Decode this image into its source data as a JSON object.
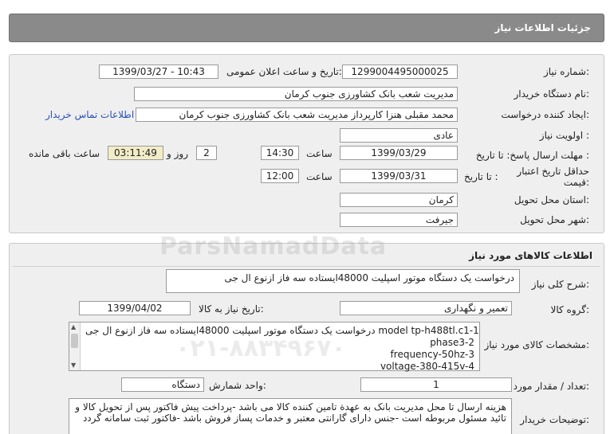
{
  "header": {
    "title": "جزئیات اطلاعات نیاز"
  },
  "details": {
    "need_number_label": "شماره نیاز:",
    "need_number": "1299004495000025",
    "announce_label": "تاریخ و ساعت اعلان عمومی:",
    "announce_value": "1399/03/27 - 10:43",
    "buyer_label": "نام دستگاه خریدار:",
    "buyer_value": "مدیریت شعب بانک کشاورزی جنوب کرمان",
    "creator_label": "ایجاد کننده درخواست:",
    "creator_value": "محمد مقبلی هنزا کارپرداز مدیریت شعب بانک کشاورزی جنوب کرمان",
    "contact_link": "اطلاعات تماس خریدار",
    "priority_label": "اولویت نیاز :",
    "priority_value": "عادی",
    "deadline_label": "مهلت ارسال پاسخ: تا تاریخ :",
    "deadline_date": "1399/03/29",
    "time_label": "ساعت",
    "deadline_time": "14:30",
    "days_value": "2",
    "days_label": "روز و",
    "remaining_time": "03:11:49",
    "remaining_label": "ساعت باقی مانده",
    "validity_label_1": "حداقل تاریخ اعتبار",
    "validity_label_2": "قیمت:",
    "validity_to_label": "تا تاریخ :",
    "validity_date": "1399/03/31",
    "validity_time_label": "ساعت",
    "validity_time": "12:00",
    "province_label": "استان محل تحویل:",
    "province_value": "کرمان",
    "city_label": "شهر محل تحویل:",
    "city_value": "جیرفت"
  },
  "goods": {
    "title": "اطلاعات کالاهای مورد نیاز",
    "summary_label": "شرح کلی نیاز:",
    "summary_value": "درخواست یک دستگاه موتور اسپلیت 48000ایستاده سه فاز ازنوع ال جی",
    "group_label": "گروه کالا:",
    "group_value": "تعمیر و نگهداری",
    "need_date_label": "تاریخ نیاز به کالا:",
    "need_date_value": "1399/04/02",
    "spec_label": "مشخصات کالای مورد نیاز:",
    "spec_lines": [
      "درخواست یک دستگاه موتور اسپلیت 48000ایستاده سه فاز ازنوع ال جی model  tp-h488tl.c1-1",
      "phase3-2",
      "frequency-50hz-3",
      "voltage-380-415v-4"
    ],
    "qty_label": "تعداد / مقدار مورد نیاز:",
    "qty_value": "1",
    "unit_label": "واحد شمارش:",
    "unit_value": "دستگاه",
    "buyer_notes_label": "توضیحات خریدار:",
    "buyer_notes": "هزینه ارسال تا محل مدیریت بانک به عهدة تامین کننده کالا می باشد -پرداخت پیش فاکتور پس از تحویل کالا و تائید مسئول مربوطه است -جنس دارای گارانتی معتبر و خدمات پساز فروش باشد -فاکتور ثبت سامانه گردد"
  },
  "watermark": {
    "text": "ParsNamadData",
    "phone": "۰۲۱-۸۸۳۴۹۶۷۰"
  }
}
